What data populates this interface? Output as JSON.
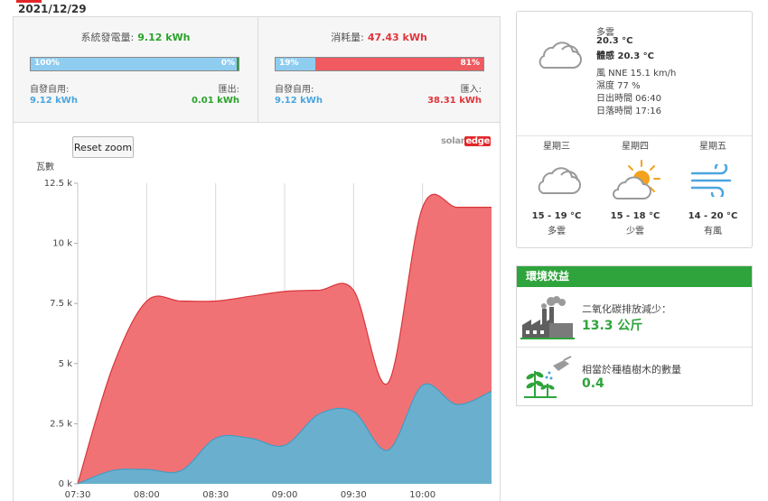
{
  "header": {
    "date": "2021/12/29"
  },
  "production": {
    "label": "系統發電量:",
    "value": "9.12 kWh",
    "bar_left_label": "100%",
    "bar_right_label": "0%",
    "self_use_fraction": 1.0,
    "self_use_label": "自發自用:",
    "self_use_value": "9.12 kWh",
    "export_label": "匯出:",
    "export_value": "0.01 kWh"
  },
  "consumption": {
    "label": "消耗量:",
    "value": "47.43 kWh",
    "bar_left_label": "19%",
    "bar_right_label": "81%",
    "self_use_fraction": 0.19,
    "self_use_label": "自發自用:",
    "self_use_value": "9.12 kWh",
    "import_label": "匯入:",
    "import_value": "38.31 kWh"
  },
  "chart_controls": {
    "reset_zoom_label": "Reset zoom"
  },
  "brand": {
    "part1": "solar",
    "part2": "edge"
  },
  "chart_data": {
    "type": "area",
    "ylabel": "瓦數",
    "xlabel": "",
    "ylim": [
      0,
      12500
    ],
    "xlim": [
      "07:30",
      "10:30"
    ],
    "x_tick_labels": [
      "07:30",
      "08:00",
      "08:30",
      "09:00",
      "09:30",
      "10:00"
    ],
    "y_tick_labels": [
      "0 k",
      "2.5 k",
      "5 k",
      "7.5 k",
      "10 k",
      "12.5 k"
    ],
    "y_tick_values": [
      0,
      2500,
      5000,
      7500,
      10000,
      12500
    ],
    "x": [
      "07:30",
      "07:45",
      "08:00",
      "08:15",
      "08:30",
      "08:45",
      "09:00",
      "09:15",
      "09:30",
      "09:45",
      "10:00",
      "10:15",
      "10:30"
    ],
    "series": [
      {
        "values": [
          0,
          4800,
          7600,
          7600,
          7600,
          7800,
          8000,
          8050,
          8050,
          4200,
          11500,
          11500,
          11500
        ],
        "color": "#f06a6e"
      },
      {
        "values": [
          0,
          550,
          600,
          550,
          1900,
          1900,
          1600,
          2900,
          3000,
          1400,
          4100,
          3300,
          3850
        ],
        "color": "#62b3d3"
      }
    ],
    "grid": true
  },
  "weather": {
    "current": {
      "condition": "多雲",
      "temp": "20.3 °C",
      "feels": "體感 20.3 °C",
      "wind": "風 NNE 15.1 km/h",
      "humidity": "濕度 77 %",
      "sunrise": "日出時間 06:40",
      "sunset": "日落時間 17:16",
      "icon": "cloudy-icon"
    },
    "forecast": [
      {
        "day": "星期三",
        "temps": "15 - 19 °C",
        "cond": "多雲",
        "icon": "cloudy-icon"
      },
      {
        "day": "星期四",
        "temps": "15 - 18 °C",
        "cond": "少雲",
        "icon": "partly-sunny-icon"
      },
      {
        "day": "星期五",
        "temps": "14 - 20 °C",
        "cond": "有風",
        "icon": "wind-icon"
      }
    ]
  },
  "environment": {
    "title": "環境效益",
    "co2_label": "二氧化碳排放減少：",
    "co2_value": "13.3 公斤",
    "co2_icon": "factory-icon",
    "trees_label": "相當於種植樹木的數量",
    "trees_value": "0.4",
    "trees_icon": "tree-watering-icon"
  },
  "colors": {
    "consumption": "#e0343b",
    "production": "#2aa22a",
    "self_use": "#4aa6df",
    "env_green": "#2fa43c"
  }
}
